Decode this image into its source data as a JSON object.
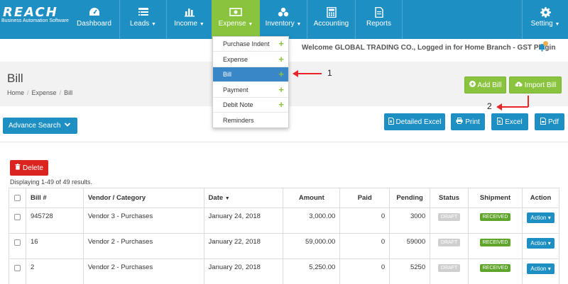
{
  "brand": {
    "name": "REACH",
    "tagline": "Business Automation Software"
  },
  "nav": [
    {
      "label": "Dashboard",
      "icon": "dashboard-icon",
      "caret": false
    },
    {
      "label": "Leads",
      "icon": "list-icon",
      "caret": true
    },
    {
      "label": "Income",
      "icon": "bar-chart-icon",
      "caret": true
    },
    {
      "label": "Expense",
      "icon": "money-icon",
      "caret": true,
      "active": true
    },
    {
      "label": "Inventory",
      "icon": "cubes-icon",
      "caret": true
    },
    {
      "label": "Accounting",
      "icon": "calculator-icon",
      "caret": false
    },
    {
      "label": "Reports",
      "icon": "file-icon",
      "caret": false
    },
    {
      "label": "Setting",
      "icon": "gear-icon",
      "caret": true
    }
  ],
  "welcome": "Welcome GLOBAL TRADING CO., Logged in for Home Branch - GST Plugin",
  "page": {
    "title": "Bill",
    "breadcrumb": [
      "Home",
      "Expense",
      "Bill"
    ]
  },
  "actions": {
    "add_bill": "Add Bill",
    "import_bill": "Import Bill",
    "advance_search": "Advance Search",
    "detailed_excel": "Detailed Excel",
    "print": "Print",
    "excel": "Excel",
    "pdf": "Pdf",
    "delete": "Delete"
  },
  "results_text": "Displaying 1-49 of 49 results.",
  "table": {
    "headers": [
      "Bill #",
      "Vendor / Category",
      "Date",
      "Amount",
      "Paid",
      "Pending",
      "Status",
      "Shipment",
      "Action"
    ],
    "sort_caret": "▼",
    "rows": [
      {
        "bill": "945728",
        "vendor": "Vendor 3 - Purchases",
        "date": "January 24, 2018",
        "amount": "3,000.00",
        "paid": "0",
        "pending": "3000",
        "status": "DRAFT",
        "shipment": "RECEIVED",
        "action": "Action"
      },
      {
        "bill": "16",
        "vendor": "Vendor 2 - Purchases",
        "date": "January 22, 2018",
        "amount": "59,000.00",
        "paid": "0",
        "pending": "59000",
        "status": "DRAFT",
        "shipment": "RECEIVED",
        "action": "Action"
      },
      {
        "bill": "2",
        "vendor": "Vendor 2 - Purchases",
        "date": "January 20, 2018",
        "amount": "5,250.00",
        "paid": "0",
        "pending": "5250",
        "status": "DRAFT",
        "shipment": "RECEIVED",
        "action": "Action"
      }
    ]
  },
  "expense_menu": [
    {
      "label": "Purchase Indent",
      "plus": true
    },
    {
      "label": "Expense",
      "plus": true
    },
    {
      "label": "Bill",
      "plus": true,
      "highlight": true
    },
    {
      "label": "Payment",
      "plus": true
    },
    {
      "label": "Debit Note",
      "plus": true
    },
    {
      "label": "Reminders",
      "plus": false
    }
  ],
  "annotations": {
    "one": "1",
    "two": "2"
  },
  "colors": {
    "primary": "#1e8fc3",
    "accent_green": "#8ac43f",
    "danger": "#d9241f",
    "annotation_red": "#e8262a"
  }
}
